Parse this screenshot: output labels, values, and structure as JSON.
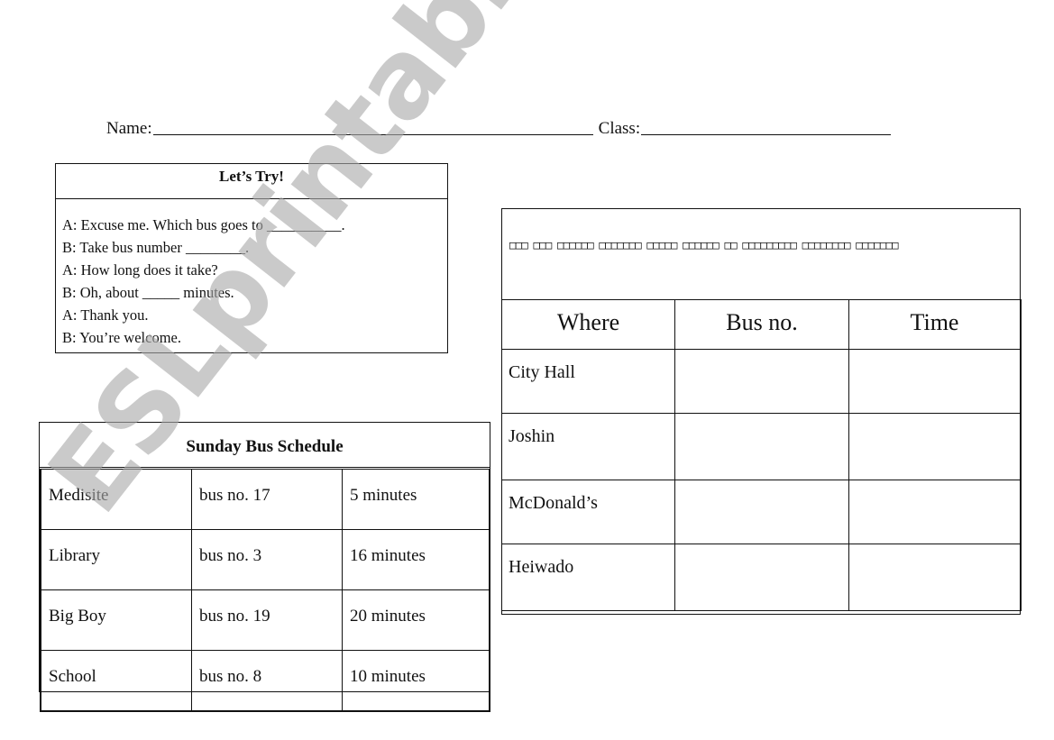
{
  "header": {
    "name_label": "Name:",
    "class_label": "Class:"
  },
  "lets_try": {
    "title": "Let’s Try!",
    "lines": [
      "A: Excuse me. Which bus goes to __________.",
      "B: Take bus number ________.",
      "A: How long does it take?",
      "B: Oh, about _____ minutes.",
      "A: Thank you.",
      "B: You’re welcome."
    ]
  },
  "schedule": {
    "title": "Sunday Bus Schedule",
    "rows": [
      {
        "place": "Medisite",
        "bus": "bus no. 17",
        "time": "5 minutes"
      },
      {
        "place": "Library",
        "bus": "bus no. 3",
        "time": "16 minutes"
      },
      {
        "place": "Big Boy",
        "bus": "bus no. 19",
        "time": "20 minutes"
      },
      {
        "place": "School",
        "bus": "bus no. 8",
        "time": "10 minutes"
      }
    ]
  },
  "answer_table": {
    "instructions": "□□□ □□□ □□□□□□ □□□□□□□ □□□□□ □□□□□□ □□ □□□□□□□□□ □□□□□□□□ □□□□□□□",
    "headers": [
      "Where",
      "Bus no.",
      "Time"
    ],
    "rows": [
      {
        "where": "City Hall",
        "bus": "",
        "time": ""
      },
      {
        "where": "Joshin",
        "bus": "",
        "time": ""
      },
      {
        "where": "McDonald’s",
        "bus": "",
        "time": ""
      },
      {
        "where": "Heiwado",
        "bus": "",
        "time": ""
      }
    ]
  },
  "watermark": {
    "text": "ESLprintables.com",
    "color": "#c4c4c4"
  }
}
